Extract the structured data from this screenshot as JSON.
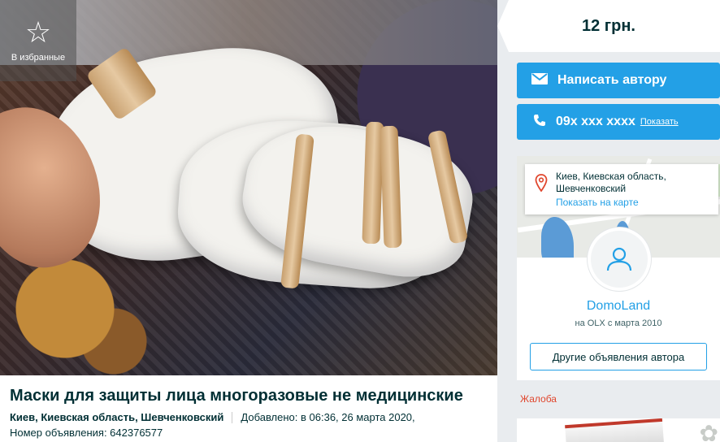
{
  "favorite": {
    "label": "В избранные",
    "icon": "star-outline-icon"
  },
  "listing": {
    "title": "Маски для защиты лица многоразовые не медицинские",
    "location": "Киев, Киевская область, Шевченковский",
    "added": "Добавлено: в 06:36, 26 марта 2020,",
    "ad_number": "Номер объявления: 642376577"
  },
  "price": {
    "value": "12 грн."
  },
  "contact": {
    "message_label": "Написать автору",
    "phone_masked": "09x xxx xxxx",
    "show_label": "Показать"
  },
  "seller": {
    "city_line1": "Киев, Киевская область,",
    "city_line2": "Шевченковский",
    "show_on_map": "Показать на карте",
    "name": "DomoLand",
    "since": "на OLX с марта 2010",
    "other_ads_label": "Другие объявления автора"
  },
  "complaint_label": "Жалоба",
  "colors": {
    "accent": "#23a0e6",
    "text": "#002f34",
    "complaint": "#e0462d"
  }
}
